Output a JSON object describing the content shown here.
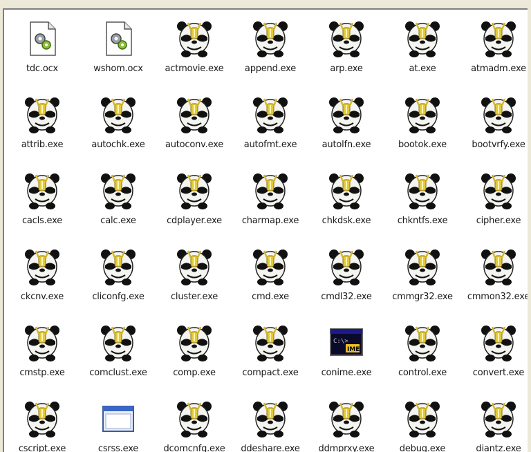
{
  "files": [
    {
      "name": "tdc.ocx",
      "icon": "activex-control-icon"
    },
    {
      "name": "wshom.ocx",
      "icon": "activex-control-icon"
    },
    {
      "name": "actmovie.exe",
      "icon": "panda-icon"
    },
    {
      "name": "append.exe",
      "icon": "panda-icon"
    },
    {
      "name": "arp.exe",
      "icon": "panda-icon"
    },
    {
      "name": "at.exe",
      "icon": "panda-icon"
    },
    {
      "name": "atmadm.exe",
      "icon": "panda-icon"
    },
    {
      "name": "attrib.exe",
      "icon": "panda-icon"
    },
    {
      "name": "autochk.exe",
      "icon": "panda-icon"
    },
    {
      "name": "autoconv.exe",
      "icon": "panda-icon"
    },
    {
      "name": "autofmt.exe",
      "icon": "panda-icon"
    },
    {
      "name": "autolfn.exe",
      "icon": "panda-icon"
    },
    {
      "name": "bootok.exe",
      "icon": "panda-icon"
    },
    {
      "name": "bootvrfy.exe",
      "icon": "panda-icon"
    },
    {
      "name": "cacls.exe",
      "icon": "panda-icon"
    },
    {
      "name": "calc.exe",
      "icon": "panda-icon"
    },
    {
      "name": "cdplayer.exe",
      "icon": "panda-icon"
    },
    {
      "name": "charmap.exe",
      "icon": "panda-icon"
    },
    {
      "name": "chkdsk.exe",
      "icon": "panda-icon"
    },
    {
      "name": "chkntfs.exe",
      "icon": "panda-icon"
    },
    {
      "name": "cipher.exe",
      "icon": "panda-icon"
    },
    {
      "name": "ckcnv.exe",
      "icon": "panda-icon"
    },
    {
      "name": "cliconfg.exe",
      "icon": "panda-icon"
    },
    {
      "name": "cluster.exe",
      "icon": "panda-icon"
    },
    {
      "name": "cmd.exe",
      "icon": "panda-icon"
    },
    {
      "name": "cmdl32.exe",
      "icon": "panda-icon"
    },
    {
      "name": "cmmgr32.exe",
      "icon": "panda-icon"
    },
    {
      "name": "cmmon32.exe",
      "icon": "panda-icon"
    },
    {
      "name": "cmstp.exe",
      "icon": "panda-icon"
    },
    {
      "name": "comclust.exe",
      "icon": "panda-icon"
    },
    {
      "name": "comp.exe",
      "icon": "panda-icon"
    },
    {
      "name": "compact.exe",
      "icon": "panda-icon"
    },
    {
      "name": "conime.exe",
      "icon": "ime-console-icon"
    },
    {
      "name": "control.exe",
      "icon": "panda-icon"
    },
    {
      "name": "convert.exe",
      "icon": "panda-icon"
    },
    {
      "name": "cscript.exe",
      "icon": "panda-icon"
    },
    {
      "name": "csrss.exe",
      "icon": "window-app-icon"
    },
    {
      "name": "dcomcnfg.exe",
      "icon": "panda-icon"
    },
    {
      "name": "ddeshare.exe",
      "icon": "panda-icon"
    },
    {
      "name": "ddmprxy.exe",
      "icon": "panda-icon"
    },
    {
      "name": "debug.exe",
      "icon": "panda-icon"
    },
    {
      "name": "diantz.exe",
      "icon": "panda-icon"
    }
  ]
}
